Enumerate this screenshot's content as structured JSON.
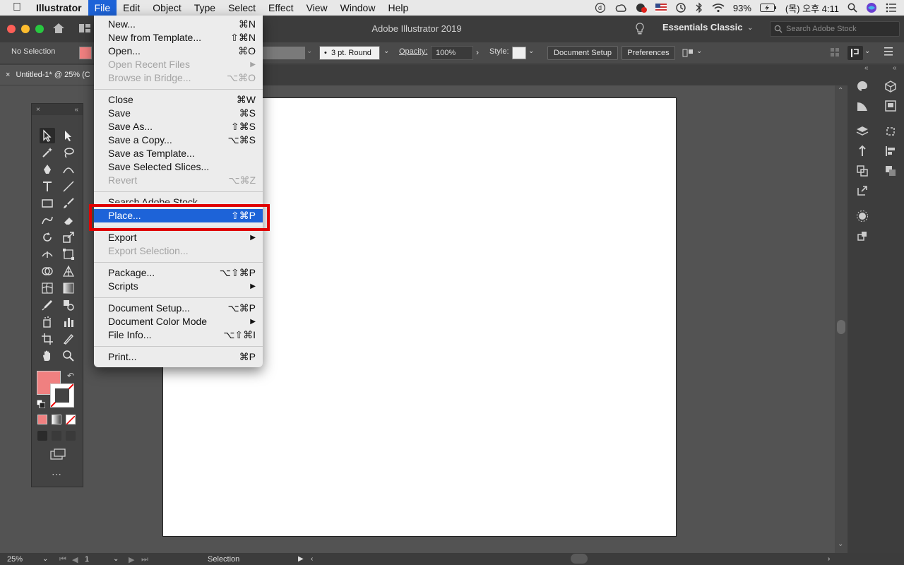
{
  "menubar": {
    "app": "Illustrator",
    "items": [
      "File",
      "Edit",
      "Object",
      "Type",
      "Select",
      "Effect",
      "View",
      "Window",
      "Help"
    ],
    "battery": "93%",
    "clock": "(목) 오후 4:11"
  },
  "titlebar": {
    "title": "Adobe Illustrator 2019",
    "workspace": "Essentials Classic",
    "search_placeholder": "Search Adobe Stock"
  },
  "controlbar": {
    "selection": "No Selection",
    "brush": "3 pt. Round",
    "opacity_label": "Opacity:",
    "opacity_value": "100%",
    "style_label": "Style:",
    "doc_setup": "Document Setup",
    "preferences": "Preferences"
  },
  "doc_tab": "Untitled-1* @ 25% (C",
  "file_menu": {
    "items": [
      {
        "label": "New...",
        "shortcut": "⌘N",
        "disabled": false
      },
      {
        "label": "New from Template...",
        "shortcut": "⇧⌘N",
        "disabled": false
      },
      {
        "label": "Open...",
        "shortcut": "⌘O",
        "disabled": false
      },
      {
        "label": "Open Recent Files",
        "shortcut": "▶",
        "disabled": true
      },
      {
        "label": "Browse in Bridge...",
        "shortcut": "⌥⌘O",
        "disabled": true
      },
      {
        "label": "Close",
        "shortcut": "⌘W",
        "disabled": false
      },
      {
        "label": "Save",
        "shortcut": "⌘S",
        "disabled": false
      },
      {
        "label": "Save As...",
        "shortcut": "⇧⌘S",
        "disabled": false
      },
      {
        "label": "Save a Copy...",
        "shortcut": "⌥⌘S",
        "disabled": false
      },
      {
        "label": "Save as Template...",
        "shortcut": "",
        "disabled": false
      },
      {
        "label": "Save Selected Slices...",
        "shortcut": "",
        "disabled": false
      },
      {
        "label": "Revert",
        "shortcut": "⌥⌘Z",
        "disabled": true
      },
      {
        "label": "Search Adobe Stock",
        "shortcut": "",
        "disabled": false
      },
      {
        "label": "Place...",
        "shortcut": "⇧⌘P",
        "disabled": false,
        "highlighted": true
      },
      {
        "label": "Export",
        "shortcut": "▶",
        "disabled": false
      },
      {
        "label": "Export Selection...",
        "shortcut": "",
        "disabled": true
      },
      {
        "label": "Package...",
        "shortcut": "⌥⇧⌘P",
        "disabled": false
      },
      {
        "label": "Scripts",
        "shortcut": "▶",
        "disabled": false
      },
      {
        "label": "Document Setup...",
        "shortcut": "⌥⌘P",
        "disabled": false
      },
      {
        "label": "Document Color Mode",
        "shortcut": "▶",
        "disabled": false
      },
      {
        "label": "File Info...",
        "shortcut": "⌥⇧⌘I",
        "disabled": false
      },
      {
        "label": "Print...",
        "shortcut": "⌘P",
        "disabled": false
      }
    ]
  },
  "statusbar": {
    "zoom": "25%",
    "page": "1",
    "tool": "Selection"
  },
  "colors": {
    "fill": "#f08080",
    "highlight": "#1d63d8",
    "callout": "#e00000"
  }
}
